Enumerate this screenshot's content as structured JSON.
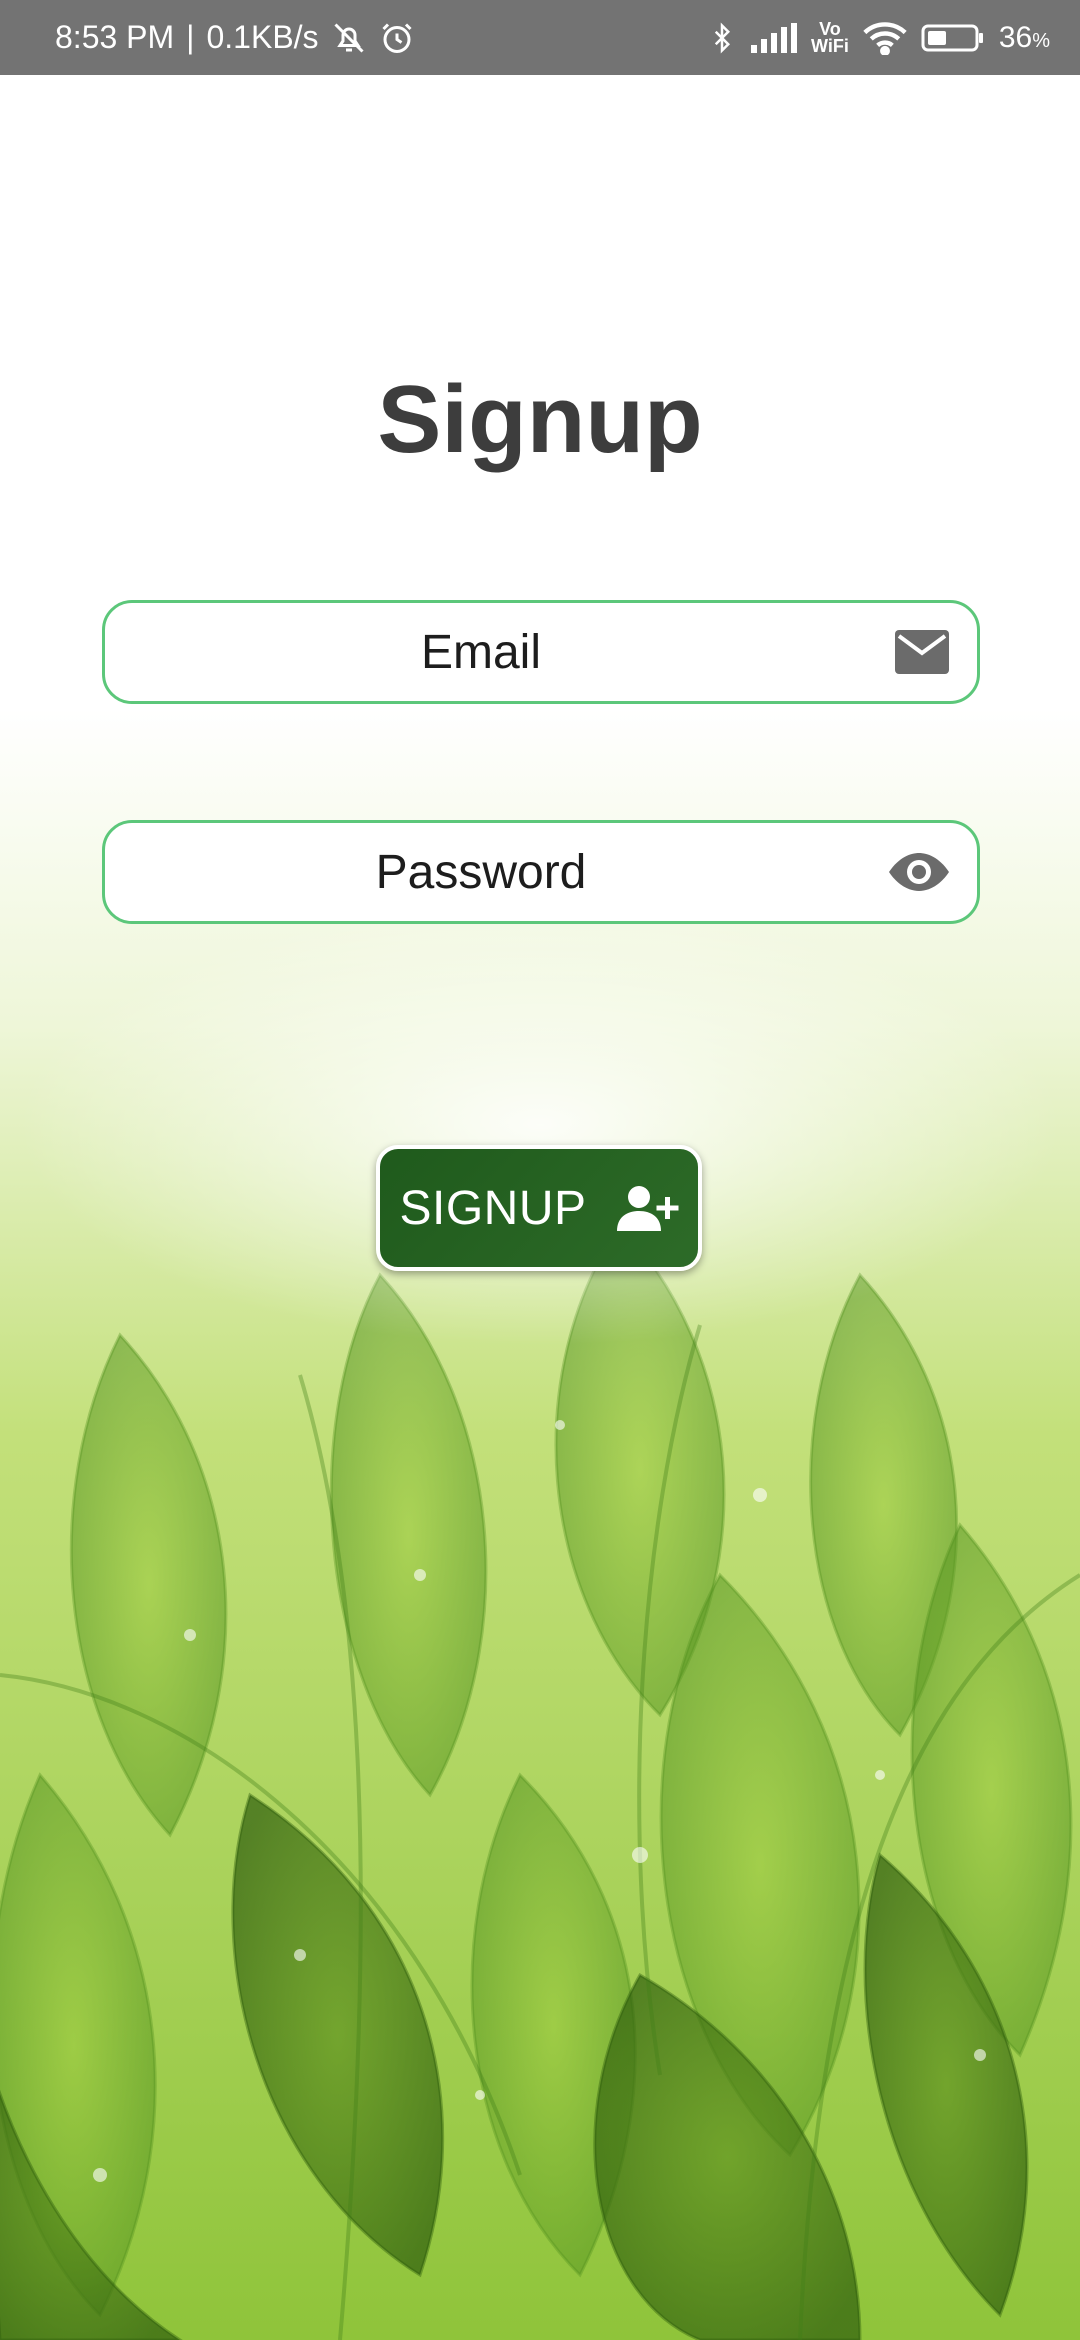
{
  "status_bar": {
    "time": "8:53 PM",
    "separator": "|",
    "network_speed": "0.1KB/s",
    "vowifi_top": "Vo",
    "vowifi_bottom": "WiFi",
    "battery_percent": "36",
    "battery_unit": "%",
    "icons": [
      "alarm-off-icon",
      "alarm-clock-icon",
      "bluetooth-icon",
      "signal-icon",
      "vowifi-icon",
      "wifi-icon",
      "battery-icon"
    ]
  },
  "page": {
    "title": "Signup"
  },
  "form": {
    "email": {
      "placeholder": "Email",
      "value": "",
      "icon": "mail-icon"
    },
    "password": {
      "placeholder": "Password",
      "value": "",
      "icon": "eye-icon"
    },
    "submit": {
      "label": "SIGNUP",
      "icon": "person-add-icon"
    }
  },
  "colors": {
    "status_bar_bg": "#737373",
    "title": "#3d3d3d",
    "field_border": "#5cc77a",
    "button_bg": "#245f20",
    "icon_grey": "#6b6b6b"
  }
}
